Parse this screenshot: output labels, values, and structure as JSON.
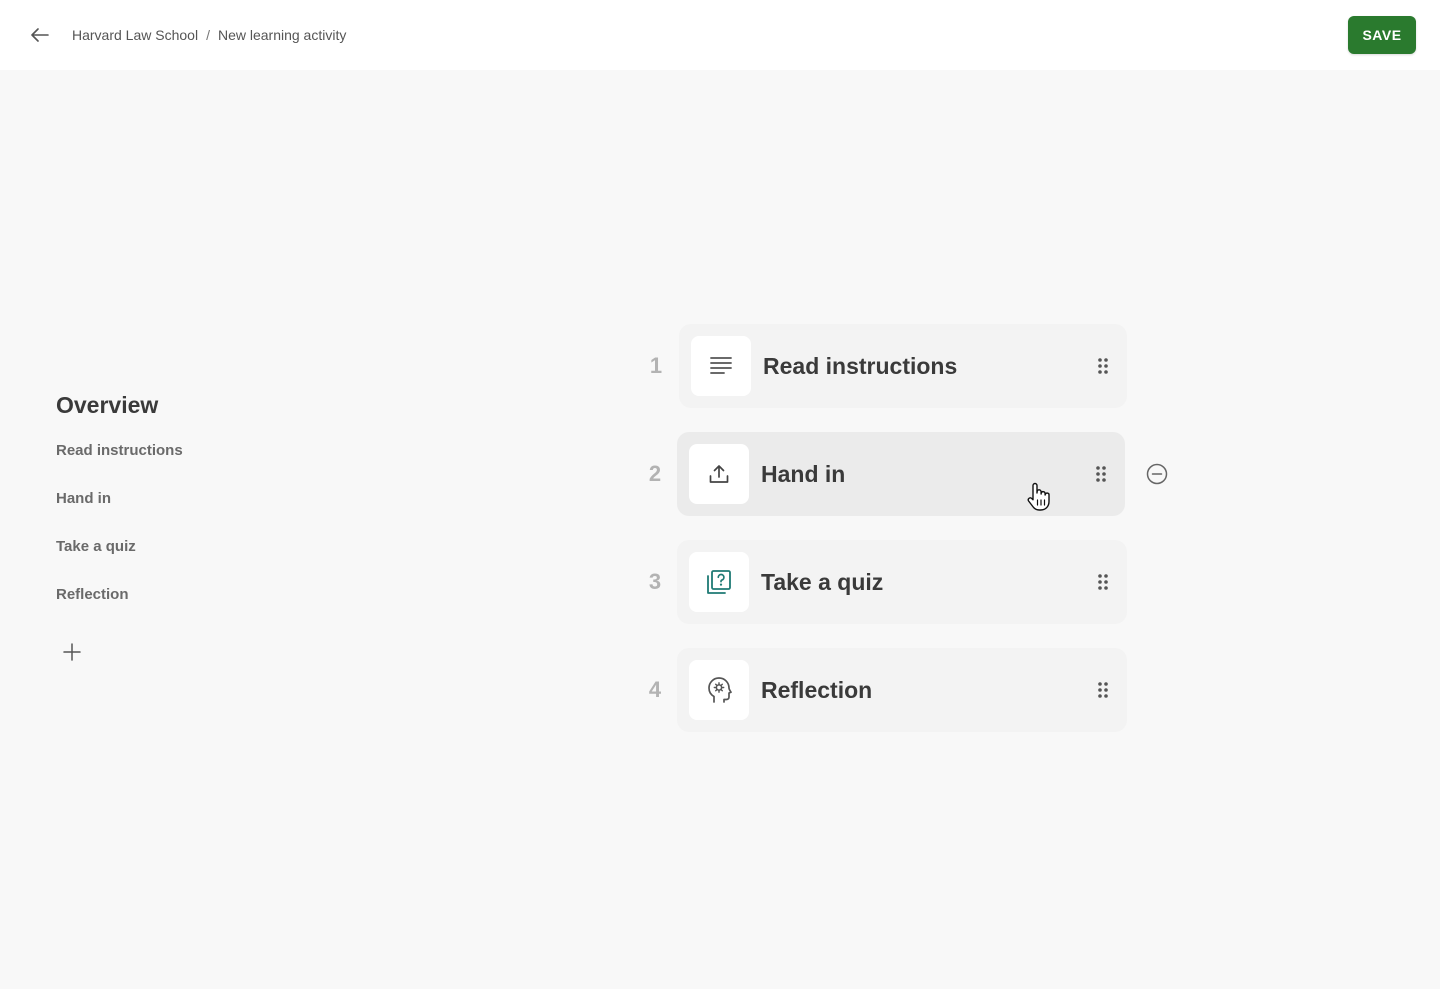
{
  "header": {
    "back_icon": "arrow-left-icon",
    "breadcrumb": {
      "items": [
        "Harvard Law School",
        "New learning activity"
      ],
      "separator": "/"
    },
    "save_label": "SAVE",
    "save_color": "#2a7a2e"
  },
  "overview": {
    "title": "Overview",
    "items": [
      {
        "label": "Read instructions"
      },
      {
        "label": "Hand in"
      },
      {
        "label": "Take a quiz"
      },
      {
        "label": "Reflection"
      }
    ],
    "add_icon": "plus-icon"
  },
  "steps": [
    {
      "number": "1",
      "title": "Read instructions",
      "icon": "text-lines-icon"
    },
    {
      "number": "2",
      "title": "Hand in",
      "icon": "upload-icon",
      "state": "hover"
    },
    {
      "number": "3",
      "title": "Take a quiz",
      "icon": "quiz-icon",
      "icon_color": "#1e7a74"
    },
    {
      "number": "4",
      "title": "Reflection",
      "icon": "head-gear-icon"
    }
  ],
  "remove_icon": "minus-circle-icon",
  "drag_icon": "drag-handle-icon"
}
